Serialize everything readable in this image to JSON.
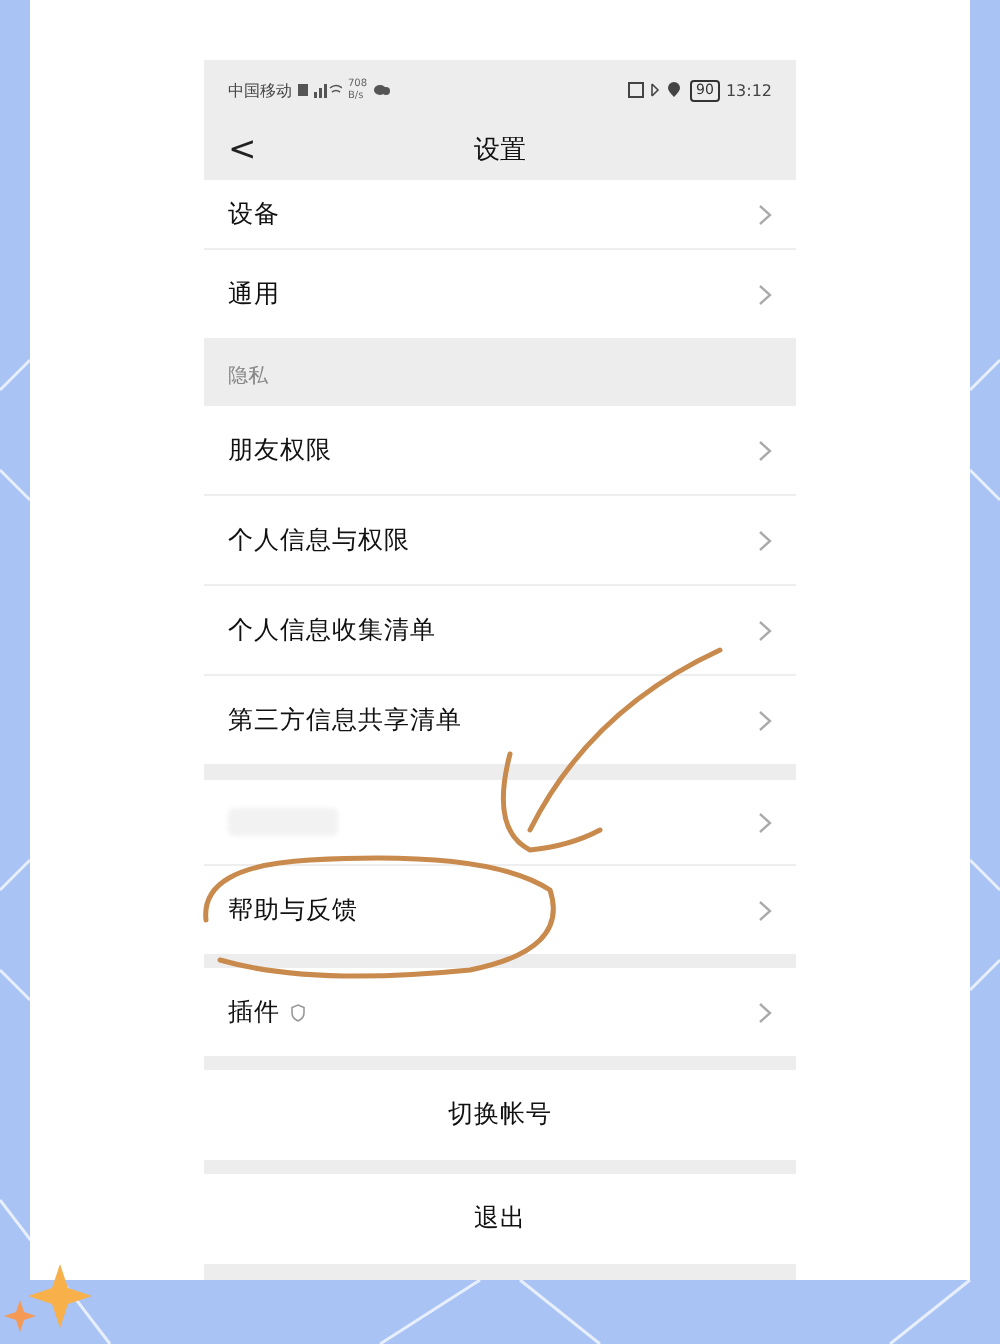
{
  "status_bar": {
    "carrier": "中国移动",
    "speed": "708",
    "speed_unit": "B/s",
    "battery": "90",
    "time": "13:12"
  },
  "nav": {
    "back": "<",
    "title": "设置"
  },
  "groups": [
    {
      "rows": [
        {
          "kind": "item",
          "label": "设备",
          "cut": true
        },
        {
          "kind": "item",
          "label": "通用"
        }
      ]
    },
    {
      "header": "隐私",
      "rows": [
        {
          "kind": "item",
          "label": "朋友权限"
        },
        {
          "kind": "item",
          "label": "个人信息与权限"
        },
        {
          "kind": "item",
          "label": "个人信息收集清单"
        },
        {
          "kind": "item",
          "label": "第三方信息共享清单"
        }
      ]
    },
    {
      "rows": [
        {
          "kind": "redacted"
        },
        {
          "kind": "item",
          "label": "帮助与反馈"
        }
      ]
    },
    {
      "rows": [
        {
          "kind": "plugin",
          "label": "插件"
        }
      ]
    },
    {
      "rows": [
        {
          "kind": "action",
          "label": "切换帐号"
        }
      ]
    },
    {
      "rows": [
        {
          "kind": "action",
          "label": "退出"
        }
      ]
    }
  ]
}
